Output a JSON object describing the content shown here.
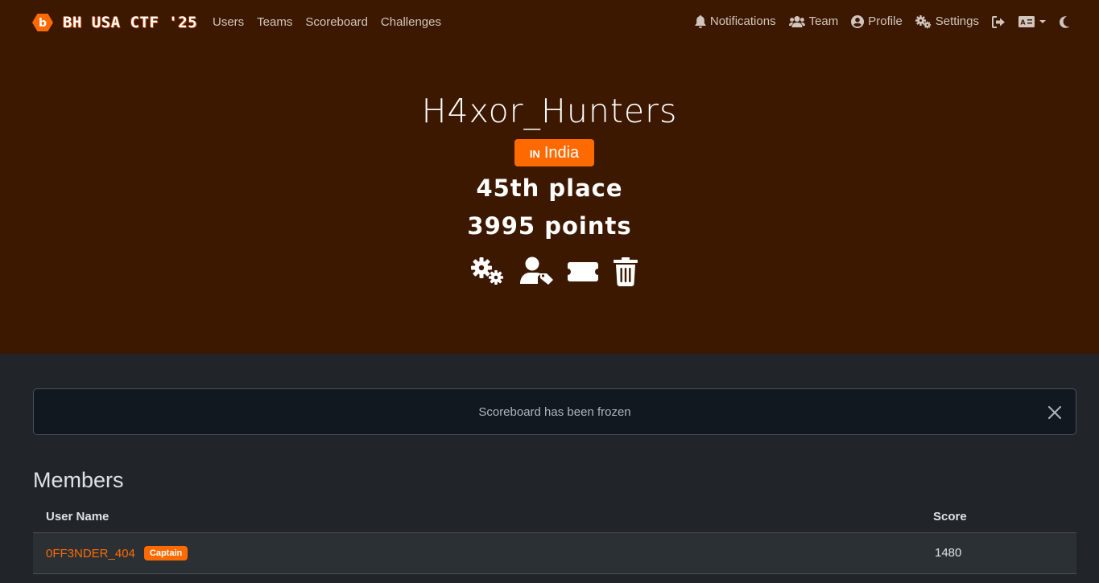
{
  "brand": {
    "title": "BH USA CTF '25",
    "logo_letter": "b"
  },
  "nav": {
    "users": "Users",
    "teams": "Teams",
    "scoreboard": "Scoreboard",
    "challenges": "Challenges",
    "notifications": "Notifications",
    "team": "Team",
    "profile": "Profile",
    "settings": "Settings"
  },
  "team": {
    "name": "H4xor_Hunters",
    "country_code": "IN",
    "country": "India",
    "place": "45th place",
    "points": "3995 points"
  },
  "alert": {
    "message": "Scoreboard has been frozen"
  },
  "members": {
    "heading": "Members",
    "columns": {
      "username": "User Name",
      "score": "Score"
    },
    "rows": [
      {
        "name": "0FF3NDER_404",
        "badge": "Captain",
        "score": "1480"
      }
    ]
  },
  "colors": {
    "accent": "#ff6a00",
    "header_bg": "#3d1800",
    "body_bg": "#212529"
  }
}
